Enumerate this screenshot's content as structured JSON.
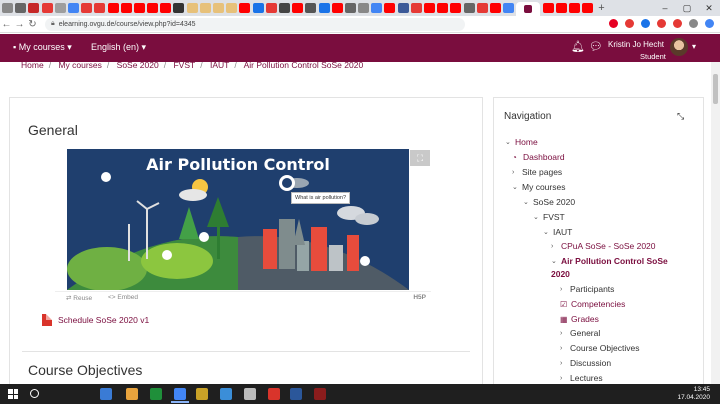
{
  "browser": {
    "url": "elearning.ovgu.de/course/view.php?id=4345",
    "tab_colors": [
      "#888",
      "#666",
      "#c62828",
      "#e53935",
      "#9e9e9e",
      "#4285f4",
      "#e53935",
      "#e53935",
      "#ff0000",
      "#ff0000",
      "#ff0000",
      "#ff0000",
      "#ff0000",
      "#333",
      "#e7c17a",
      "#e7c17a",
      "#e7c17a",
      "#e7c17a",
      "#ff0000",
      "#1a73e8",
      "#e53935",
      "#444",
      "#ff0000",
      "#555",
      "#1a73e8",
      "#ff0000",
      "#666",
      "#888",
      "#4285f4",
      "#ff0000",
      "#3b5998",
      "#e53935",
      "#ff0000",
      "#ff0000",
      "#ff0000",
      "#666",
      "#e53935",
      "#ff0000",
      "#4285f4",
      "#ff0000",
      "#ff0000",
      "#ff0000",
      "#ff0000"
    ],
    "extension_colors": [
      "#e60023",
      "#e53935",
      "#1a73e8",
      "#e53935",
      "#e53935",
      "#888",
      "#4285f4"
    ],
    "new_tab_symbol": "+",
    "window_controls": [
      "–",
      "▢",
      "✕"
    ]
  },
  "navbar": {
    "my_courses": "My courses",
    "language": "English (en)",
    "user_name": "Kristin Jo Hecht",
    "user_role": "Student",
    "accent": "#7a0d3e"
  },
  "breadcrumb": [
    "Home",
    "My courses",
    "SoSe 2020",
    "FVST",
    "IAUT",
    "Air Pollution Control SoSe 2020"
  ],
  "main": {
    "section_general": "General",
    "hero_title": "Air Pollution Control",
    "hotspot_tooltip": "What is air pollution?",
    "reuse_label": "Reuse",
    "embed_label": "Embed",
    "h5p_label": "H5P",
    "schedule_link": "Schedule SoSe 2020 v1",
    "section_objectives": "Course Objectives"
  },
  "navigation": {
    "title": "Navigation",
    "items": [
      {
        "label": "Home",
        "style": "link",
        "chevron": "⌄"
      },
      {
        "label": "Dashboard",
        "style": "link",
        "icon": "dashboard-icon"
      },
      {
        "label": "Site pages",
        "style": "plain",
        "chevron": "›"
      },
      {
        "label": "My courses",
        "style": "plain",
        "chevron": "⌄"
      },
      {
        "label": "SoSe 2020",
        "style": "plain",
        "chevron": "⌄"
      },
      {
        "label": "FVST",
        "style": "plain",
        "chevron": "⌄"
      },
      {
        "label": "IAUT",
        "style": "plain",
        "chevron": "⌄"
      },
      {
        "label": "CPuA SoSe - SoSe 2020",
        "style": "link",
        "chevron": "›"
      },
      {
        "label": "Air Pollution Control SoSe",
        "label2": "2020",
        "style": "bold",
        "chevron": "⌄"
      },
      {
        "label": "Participants",
        "style": "plain",
        "chevron": "›"
      },
      {
        "label": "Competencies",
        "style": "link",
        "icon": "check-square-icon"
      },
      {
        "label": "Grades",
        "style": "link",
        "icon": "table-icon"
      },
      {
        "label": "General",
        "style": "plain",
        "chevron": "›"
      },
      {
        "label": "Course Objectives",
        "style": "plain",
        "chevron": "›"
      },
      {
        "label": "Discussion",
        "style": "plain",
        "chevron": "›"
      },
      {
        "label": "Lectures",
        "style": "plain",
        "chevron": "›"
      }
    ]
  },
  "taskbar": {
    "time": "13:45",
    "date": "17.04.2020",
    "app_colors": [
      "#3a7bd5",
      "#e8a33d",
      "#1f8f3a",
      "#4285f4",
      "#c9a227",
      "#3b8ed8",
      "#bbb",
      "#d9342b",
      "#2b579a",
      "#8a1c1c"
    ]
  }
}
